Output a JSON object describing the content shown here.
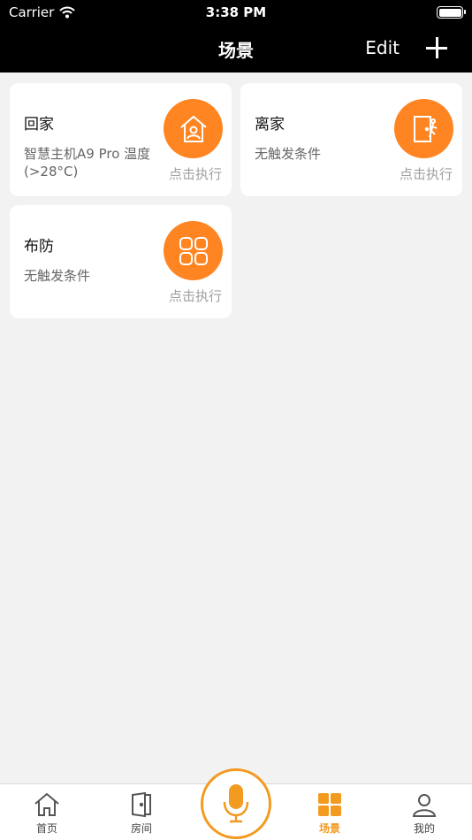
{
  "status_bar": {
    "carrier": "Carrier",
    "time": "3:38 PM"
  },
  "nav": {
    "title": "场景",
    "edit_label": "Edit"
  },
  "scenes": [
    {
      "name": "回家",
      "condition": "智慧主机A9 Pro 温度(>28°C)",
      "action": "点击执行",
      "icon": "home-icon"
    },
    {
      "name": "离家",
      "condition": "无触发条件",
      "action": "点击执行",
      "icon": "leave-door-icon"
    },
    {
      "name": "布防",
      "condition": "无触发条件",
      "action": "点击执行",
      "icon": "grid-arm-icon"
    }
  ],
  "tabs": [
    {
      "label": "首页",
      "icon": "home-outline-icon"
    },
    {
      "label": "房间",
      "icon": "door-icon"
    },
    {
      "label": "场景",
      "icon": "scene-grid-icon",
      "active": true
    },
    {
      "label": "我的",
      "icon": "person-icon"
    }
  ],
  "colors": {
    "accent": "#ff8522",
    "tab_active": "#f39a21",
    "background": "#f2f2f2"
  }
}
